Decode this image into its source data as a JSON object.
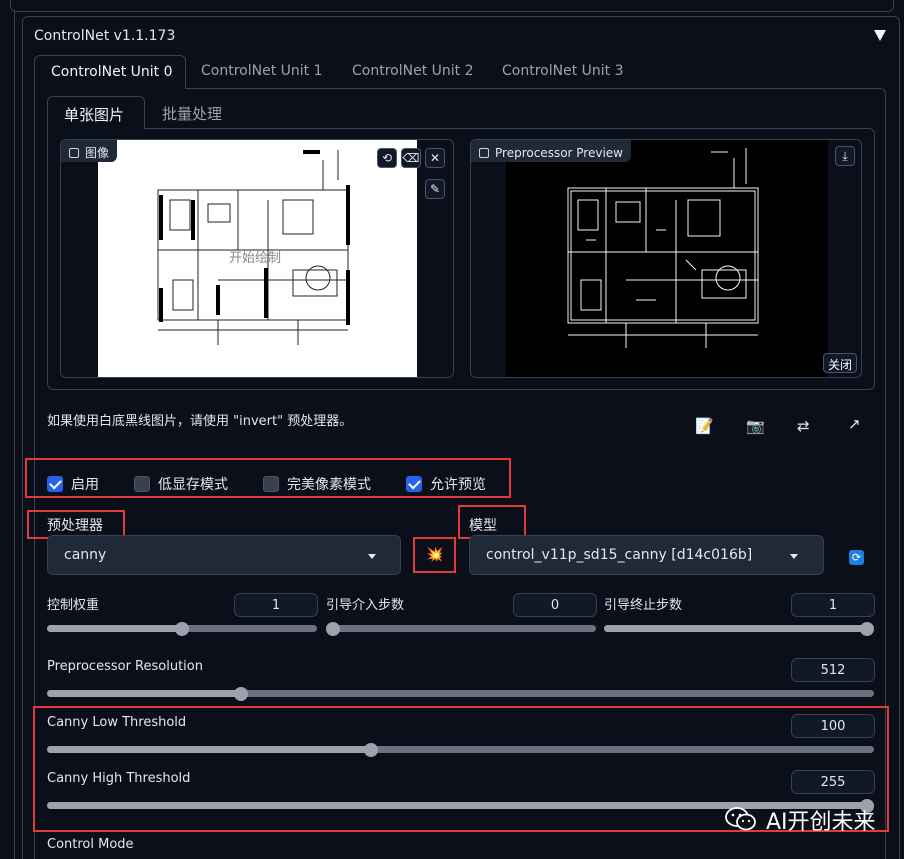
{
  "accordion": {
    "title": "ControlNet v1.1.173"
  },
  "unit_tabs": [
    "ControlNet Unit 0",
    "ControlNet Unit 1",
    "ControlNet Unit 2",
    "ControlNet Unit 3"
  ],
  "sub_tabs": [
    "单张图片",
    "批量处理"
  ],
  "image_panel": {
    "label": "图像",
    "overlay_text": "开始绘制"
  },
  "preview_panel": {
    "label": "Preprocessor Preview",
    "close_label": "关闭"
  },
  "hint": "如果使用白底黑线图片，请使用 \"invert\" 预处理器。",
  "checkboxes": [
    {
      "label": "启用",
      "checked": true
    },
    {
      "label": "低显存模式",
      "checked": false
    },
    {
      "label": "完美像素模式",
      "checked": false
    },
    {
      "label": "允许预览",
      "checked": true
    }
  ],
  "preprocessor": {
    "label": "预处理器",
    "value": "canny"
  },
  "model": {
    "label": "模型",
    "value": "control_v11p_sd15_canny [d14c016b]"
  },
  "sliders": {
    "weight": {
      "label": "控制权重",
      "value": "1",
      "fraction": 0.5
    },
    "start": {
      "label": "引导介入步数",
      "value": "0",
      "fraction": 0.0
    },
    "end": {
      "label": "引导终止步数",
      "value": "1",
      "fraction": 1.0
    },
    "resolution": {
      "label": "Preprocessor Resolution",
      "value": "512",
      "fraction": 0.23
    },
    "low": {
      "label": "Canny Low Threshold",
      "value": "100",
      "fraction": 0.39
    },
    "high": {
      "label": "Canny High Threshold",
      "value": "255",
      "fraction": 1.0
    }
  },
  "control_mode": {
    "label": "Control Mode"
  },
  "watermark": "AI开创未来",
  "colors": {
    "accent": "#2563eb",
    "highlight": "#e03c3c"
  }
}
